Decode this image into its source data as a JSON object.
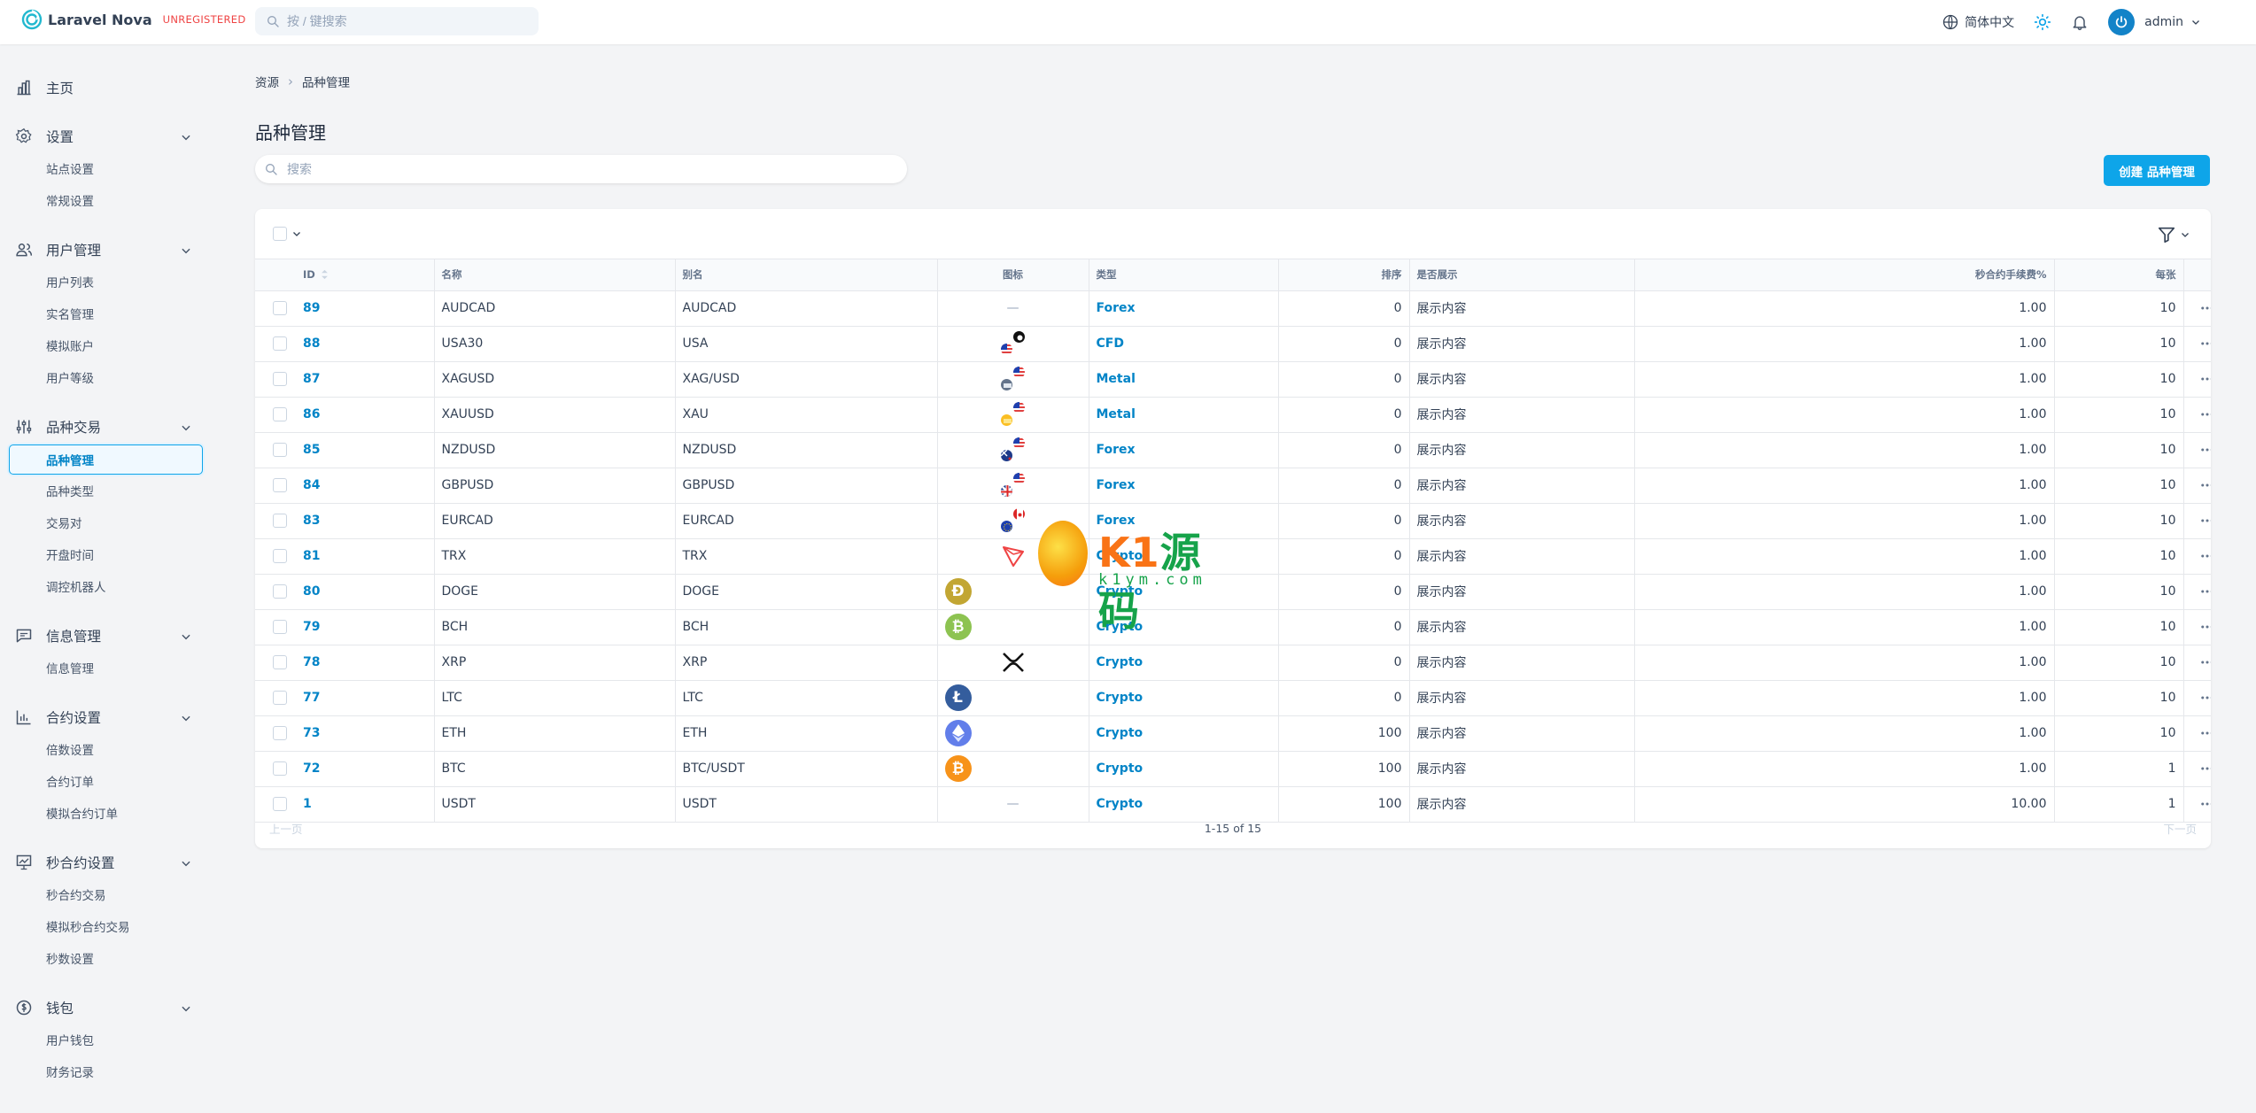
{
  "app": {
    "brand": "Laravel Nova",
    "license_badge": "UNREGISTERED"
  },
  "colors": {
    "accent": "#0ea5e9",
    "link": "#0284c7",
    "badge": "#ef4444"
  },
  "search": {
    "placeholder": "按 / 键搜索"
  },
  "topbar": {
    "language": "简体中文",
    "user": "admin"
  },
  "sidebar": {
    "home": "主页",
    "groups": [
      {
        "label": "设置",
        "icon": "gear-icon",
        "items": [
          "站点设置",
          "常规设置"
        ]
      },
      {
        "label": "用户管理",
        "icon": "users-icon",
        "items": [
          "用户列表",
          "实名管理",
          "模拟账户",
          "用户等级"
        ]
      },
      {
        "label": "品种交易",
        "icon": "sliders-icon",
        "items": [
          "品种管理",
          "品种类型",
          "交易对",
          "开盘时间",
          "调控机器人"
        ],
        "active": "品种管理"
      },
      {
        "label": "信息管理",
        "icon": "message-icon",
        "items": [
          "信息管理"
        ]
      },
      {
        "label": "合约设置",
        "icon": "chart-icon",
        "items": [
          "倍数设置",
          "合约订单",
          "模拟合约订单"
        ]
      },
      {
        "label": "秒合约设置",
        "icon": "presentation-chart-icon",
        "items": [
          "秒合约交易",
          "模拟秒合约交易",
          "秒数设置"
        ]
      },
      {
        "label": "钱包",
        "icon": "wallet-icon",
        "items": [
          "用户钱包",
          "财务记录"
        ]
      }
    ]
  },
  "breadcrumb": {
    "root": "资源",
    "current": "品种管理"
  },
  "page": {
    "title": "品种管理",
    "search_placeholder": "搜索",
    "create_button": "创建 品种管理"
  },
  "table": {
    "headers": {
      "id": "ID",
      "name": "名称",
      "alias": "别名",
      "icon": "图标",
      "type": "类型",
      "sort": "排序",
      "visible": "是否展示",
      "fee": "秒合约手续费%",
      "per": "每张"
    },
    "rows": [
      {
        "id": "89",
        "name": "AUDCAD",
        "alias": "AUDCAD",
        "icon": "none",
        "type": "Forex",
        "sort": "0",
        "visible": "展示内容",
        "fee": "1.00",
        "per": "10"
      },
      {
        "id": "88",
        "name": "USA30",
        "alias": "USA",
        "icon": "us-cfd-icon",
        "type": "CFD",
        "sort": "0",
        "visible": "展示内容",
        "fee": "1.00",
        "per": "10"
      },
      {
        "id": "87",
        "name": "XAGUSD",
        "alias": "XAG/USD",
        "icon": "silver-usd-icon",
        "type": "Metal",
        "sort": "0",
        "visible": "展示内容",
        "fee": "1.00",
        "per": "10"
      },
      {
        "id": "86",
        "name": "XAUUSD",
        "alias": "XAU",
        "icon": "gold-usd-icon",
        "type": "Metal",
        "sort": "0",
        "visible": "展示内容",
        "fee": "1.00",
        "per": "10"
      },
      {
        "id": "85",
        "name": "NZDUSD",
        "alias": "NZDUSD",
        "icon": "nz-us-flag-icon",
        "type": "Forex",
        "sort": "0",
        "visible": "展示内容",
        "fee": "1.00",
        "per": "10"
      },
      {
        "id": "84",
        "name": "GBPUSD",
        "alias": "GBPUSD",
        "icon": "gb-us-flag-icon",
        "type": "Forex",
        "sort": "0",
        "visible": "展示内容",
        "fee": "1.00",
        "per": "10"
      },
      {
        "id": "83",
        "name": "EURCAD",
        "alias": "EURCAD",
        "icon": "eu-ca-flag-icon",
        "type": "Forex",
        "sort": "0",
        "visible": "展示内容",
        "fee": "1.00",
        "per": "10"
      },
      {
        "id": "81",
        "name": "TRX",
        "alias": "TRX",
        "icon": "tron-icon",
        "type": "Crypto",
        "sort": "0",
        "visible": "展示内容",
        "fee": "1.00",
        "per": "10"
      },
      {
        "id": "80",
        "name": "DOGE",
        "alias": "DOGE",
        "icon": "doge-icon",
        "type": "Crypto",
        "sort": "0",
        "visible": "展示内容",
        "fee": "1.00",
        "per": "10"
      },
      {
        "id": "79",
        "name": "BCH",
        "alias": "BCH",
        "icon": "bch-icon",
        "type": "Crypto",
        "sort": "0",
        "visible": "展示内容",
        "fee": "1.00",
        "per": "10"
      },
      {
        "id": "78",
        "name": "XRP",
        "alias": "XRP",
        "icon": "xrp-icon",
        "type": "Crypto",
        "sort": "0",
        "visible": "展示内容",
        "fee": "1.00",
        "per": "10"
      },
      {
        "id": "77",
        "name": "LTC",
        "alias": "LTC",
        "icon": "ltc-icon",
        "type": "Crypto",
        "sort": "0",
        "visible": "展示内容",
        "fee": "1.00",
        "per": "10"
      },
      {
        "id": "73",
        "name": "ETH",
        "alias": "ETH",
        "icon": "eth-icon",
        "type": "Crypto",
        "sort": "100",
        "visible": "展示内容",
        "fee": "1.00",
        "per": "10"
      },
      {
        "id": "72",
        "name": "BTC",
        "alias": "BTC/USDT",
        "icon": "btc-icon",
        "type": "Crypto",
        "sort": "100",
        "visible": "展示内容",
        "fee": "1.00",
        "per": "1"
      },
      {
        "id": "1",
        "name": "USDT",
        "alias": "USDT",
        "icon": "none",
        "type": "Crypto",
        "sort": "100",
        "visible": "展示内容",
        "fee": "10.00",
        "per": "1"
      }
    ]
  },
  "pagination": {
    "prev": "上一页",
    "range": "1-15 of 15",
    "next": "下一页"
  },
  "watermark": {
    "text_a": "K1",
    "text_b": "源码",
    "sub": "k1ym.com"
  }
}
